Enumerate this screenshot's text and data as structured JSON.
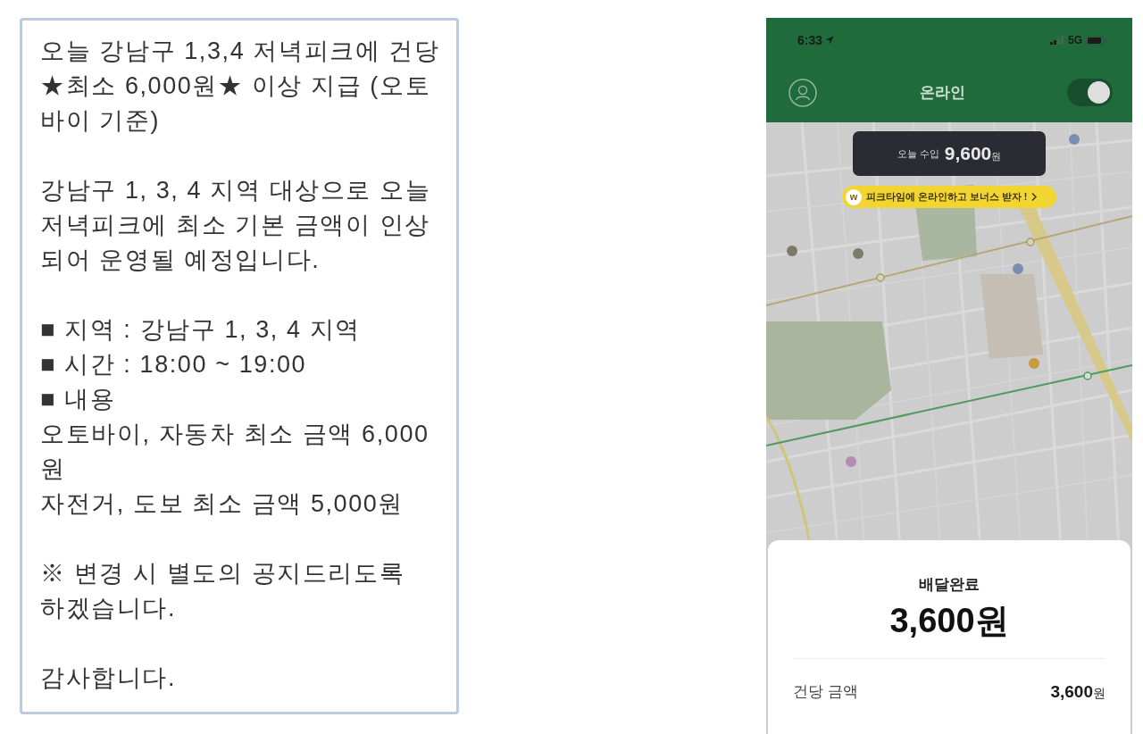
{
  "notice": {
    "paragraphs": [
      {
        "lines": [
          "오늘 강남구 1,3,4 저녁피크에 건당",
          "★최소 6,000원★ 이상 지급 (오토",
          "바이 기준)"
        ]
      },
      {
        "lines": [
          "강남구 1, 3, 4 지역 대상으로 오늘",
          "저녁피크에 최소 기본 금액이 인상",
          "되어 운영될 예정입니다."
        ]
      },
      {
        "lines": [
          "■ 지역 : 강남구 1, 3, 4 지역",
          "■ 시간 : 18:00 ~ 19:00",
          "■ 내용",
          "오토바이, 자동차 최소 금액 6,000",
          "원",
          "자전거, 도보 최소 금액 5,000원"
        ]
      },
      {
        "lines": [
          "※ 변경 시 별도의 공지드리도록",
          "하겠습니다."
        ]
      },
      {
        "lines": [
          "감사합니다."
        ]
      }
    ]
  },
  "phone": {
    "status_bar": {
      "time": "6:33",
      "network": "5G"
    },
    "header": {
      "title": "온라인",
      "online_toggle": {
        "on": true
      }
    },
    "earnings": {
      "label": "오늘 수입",
      "amount": "9,600",
      "unit": "원"
    },
    "promo_banner": {
      "badge": "w",
      "text": "피크타임에 온라인하고 보너스 받자 !"
    },
    "delivery_card": {
      "status": "배달완료",
      "total": "3,600원",
      "rows": [
        {
          "label": "건당 금액",
          "amount": "3,600",
          "unit": "원"
        }
      ]
    }
  }
}
